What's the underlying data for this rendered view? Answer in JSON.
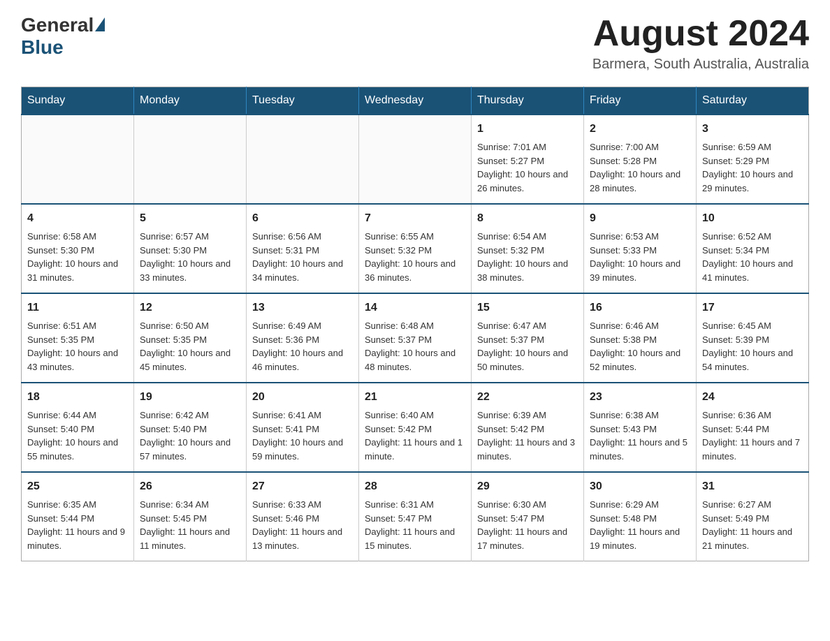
{
  "logo": {
    "general": "General",
    "blue": "Blue"
  },
  "title": "August 2024",
  "location": "Barmera, South Australia, Australia",
  "days_of_week": [
    "Sunday",
    "Monday",
    "Tuesday",
    "Wednesday",
    "Thursday",
    "Friday",
    "Saturday"
  ],
  "weeks": [
    [
      {
        "day": "",
        "info": ""
      },
      {
        "day": "",
        "info": ""
      },
      {
        "day": "",
        "info": ""
      },
      {
        "day": "",
        "info": ""
      },
      {
        "day": "1",
        "info": "Sunrise: 7:01 AM\nSunset: 5:27 PM\nDaylight: 10 hours and 26 minutes."
      },
      {
        "day": "2",
        "info": "Sunrise: 7:00 AM\nSunset: 5:28 PM\nDaylight: 10 hours and 28 minutes."
      },
      {
        "day": "3",
        "info": "Sunrise: 6:59 AM\nSunset: 5:29 PM\nDaylight: 10 hours and 29 minutes."
      }
    ],
    [
      {
        "day": "4",
        "info": "Sunrise: 6:58 AM\nSunset: 5:30 PM\nDaylight: 10 hours and 31 minutes."
      },
      {
        "day": "5",
        "info": "Sunrise: 6:57 AM\nSunset: 5:30 PM\nDaylight: 10 hours and 33 minutes."
      },
      {
        "day": "6",
        "info": "Sunrise: 6:56 AM\nSunset: 5:31 PM\nDaylight: 10 hours and 34 minutes."
      },
      {
        "day": "7",
        "info": "Sunrise: 6:55 AM\nSunset: 5:32 PM\nDaylight: 10 hours and 36 minutes."
      },
      {
        "day": "8",
        "info": "Sunrise: 6:54 AM\nSunset: 5:32 PM\nDaylight: 10 hours and 38 minutes."
      },
      {
        "day": "9",
        "info": "Sunrise: 6:53 AM\nSunset: 5:33 PM\nDaylight: 10 hours and 39 minutes."
      },
      {
        "day": "10",
        "info": "Sunrise: 6:52 AM\nSunset: 5:34 PM\nDaylight: 10 hours and 41 minutes."
      }
    ],
    [
      {
        "day": "11",
        "info": "Sunrise: 6:51 AM\nSunset: 5:35 PM\nDaylight: 10 hours and 43 minutes."
      },
      {
        "day": "12",
        "info": "Sunrise: 6:50 AM\nSunset: 5:35 PM\nDaylight: 10 hours and 45 minutes."
      },
      {
        "day": "13",
        "info": "Sunrise: 6:49 AM\nSunset: 5:36 PM\nDaylight: 10 hours and 46 minutes."
      },
      {
        "day": "14",
        "info": "Sunrise: 6:48 AM\nSunset: 5:37 PM\nDaylight: 10 hours and 48 minutes."
      },
      {
        "day": "15",
        "info": "Sunrise: 6:47 AM\nSunset: 5:37 PM\nDaylight: 10 hours and 50 minutes."
      },
      {
        "day": "16",
        "info": "Sunrise: 6:46 AM\nSunset: 5:38 PM\nDaylight: 10 hours and 52 minutes."
      },
      {
        "day": "17",
        "info": "Sunrise: 6:45 AM\nSunset: 5:39 PM\nDaylight: 10 hours and 54 minutes."
      }
    ],
    [
      {
        "day": "18",
        "info": "Sunrise: 6:44 AM\nSunset: 5:40 PM\nDaylight: 10 hours and 55 minutes."
      },
      {
        "day": "19",
        "info": "Sunrise: 6:42 AM\nSunset: 5:40 PM\nDaylight: 10 hours and 57 minutes."
      },
      {
        "day": "20",
        "info": "Sunrise: 6:41 AM\nSunset: 5:41 PM\nDaylight: 10 hours and 59 minutes."
      },
      {
        "day": "21",
        "info": "Sunrise: 6:40 AM\nSunset: 5:42 PM\nDaylight: 11 hours and 1 minute."
      },
      {
        "day": "22",
        "info": "Sunrise: 6:39 AM\nSunset: 5:42 PM\nDaylight: 11 hours and 3 minutes."
      },
      {
        "day": "23",
        "info": "Sunrise: 6:38 AM\nSunset: 5:43 PM\nDaylight: 11 hours and 5 minutes."
      },
      {
        "day": "24",
        "info": "Sunrise: 6:36 AM\nSunset: 5:44 PM\nDaylight: 11 hours and 7 minutes."
      }
    ],
    [
      {
        "day": "25",
        "info": "Sunrise: 6:35 AM\nSunset: 5:44 PM\nDaylight: 11 hours and 9 minutes."
      },
      {
        "day": "26",
        "info": "Sunrise: 6:34 AM\nSunset: 5:45 PM\nDaylight: 11 hours and 11 minutes."
      },
      {
        "day": "27",
        "info": "Sunrise: 6:33 AM\nSunset: 5:46 PM\nDaylight: 11 hours and 13 minutes."
      },
      {
        "day": "28",
        "info": "Sunrise: 6:31 AM\nSunset: 5:47 PM\nDaylight: 11 hours and 15 minutes."
      },
      {
        "day": "29",
        "info": "Sunrise: 6:30 AM\nSunset: 5:47 PM\nDaylight: 11 hours and 17 minutes."
      },
      {
        "day": "30",
        "info": "Sunrise: 6:29 AM\nSunset: 5:48 PM\nDaylight: 11 hours and 19 minutes."
      },
      {
        "day": "31",
        "info": "Sunrise: 6:27 AM\nSunset: 5:49 PM\nDaylight: 11 hours and 21 minutes."
      }
    ]
  ]
}
